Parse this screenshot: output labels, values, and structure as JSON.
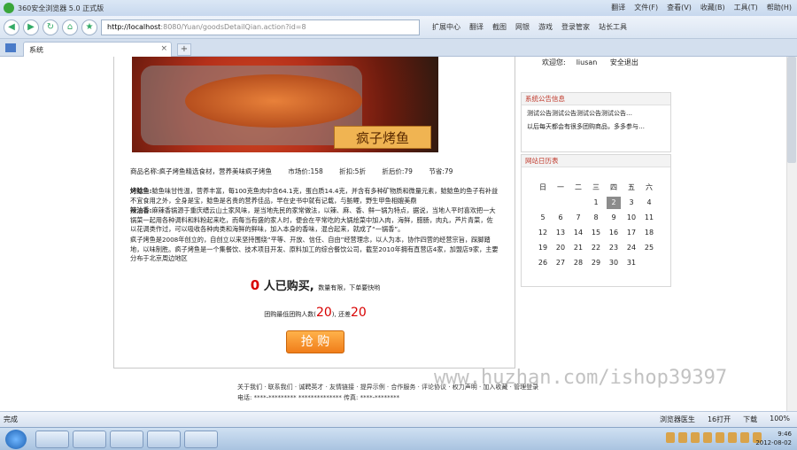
{
  "browser": {
    "title": "360安全浏览器 5.0 正式版",
    "menus": [
      "翻译",
      "文件(F)",
      "查看(V)",
      "收藏(B)",
      "工具(T)",
      "帮助(H)"
    ],
    "address_host": "http://localhost",
    "address_rest": ":8080/Yuan/goodsDetailQian.action?id=8",
    "tools": [
      "扩展中心",
      "翻译",
      "截图",
      "网银",
      "游戏",
      "登录管家",
      "站长工具"
    ],
    "tab_label": "系统",
    "tab_close": "×",
    "new_tab": "+",
    "status_text": "完成",
    "status_items": [
      "浏览器医生",
      "16打开",
      "下载",
      "100%"
    ]
  },
  "user": {
    "greeting": "欢迎您:",
    "name": "liusan",
    "logout": "安全退出"
  },
  "notice": {
    "title": "系统公告信息",
    "items": [
      "测试公告测试公告测试公告测试公告…",
      "以后每天都会有很多团购商品，多多参与…"
    ]
  },
  "calendar": {
    "title": "网站日历表",
    "weekdays": [
      "日",
      "一",
      "二",
      "三",
      "四",
      "五",
      "六"
    ],
    "rows": [
      [
        "",
        "",
        "",
        "1",
        "2",
        "3",
        "4"
      ],
      [
        "5",
        "6",
        "7",
        "8",
        "9",
        "10",
        "11"
      ],
      [
        "12",
        "13",
        "14",
        "15",
        "16",
        "17",
        "18"
      ],
      [
        "19",
        "20",
        "21",
        "22",
        "23",
        "24",
        "25"
      ],
      [
        "26",
        "27",
        "28",
        "29",
        "30",
        "31",
        ""
      ]
    ],
    "today": "2"
  },
  "product": {
    "image_sign": "疯子烤鱼",
    "name_label": "商品名称:疯子烤鱼精选食材，营养美味疯子烤鱼",
    "market_price": "市场价:158",
    "discount": "折扣:5折",
    "discount_price": "折后价:79",
    "saving": "节省:79",
    "desc_head1": "烤鲶鱼:",
    "desc_p1": "鲶鱼味甘性温，营养丰富，每100克鱼肉中含64.1克，蛋白质14.4克，并含有多种矿物质和微量元素，鲶鲶鱼的鱼子有补益不宜食用之外，全身是宝，鲶鱼是名贵的营养佳品，早在史书中就有记载，与鲂鲤，野生甲鱼相媲美鼎",
    "desc_head2": "辣油香:",
    "desc_p2": "麻辣香锅源于重庆缙云山土家风味，是当地先民的家常做法，以辣、麻、香、鲜一锅为特点，据说，当地人平时喜欢把一大锅菜一起用各种调料和料粉起来吃，而每当有盛的家人时，便会在平常吃的大锅烩菜中加入肉，海鲜，腊肠，肉丸，芦片青菜，佐以花调类作过，可以吸收各种肉类和海鲜的鲜味，加入本身的香味，混合起来，就成了“一锅香”。",
    "desc_p3": "疯子烤鱼是2008年创立的，自创立以来坚持围绕“平等、开放、信任、自由”经营理念，以人为本，协作四营的经营宗旨，踩脚踏地，以味制胜。疯子烤鱼是一个集餐饮、技术项目开发、原料加工的综合餐饮公司，截至2010年拥有直营店4家，加盟店9家，主要分布于北京周边地区",
    "bought_num": "0",
    "bought_text": "人已购买,",
    "bought_note": "数量有限，下单要快哟",
    "needed_prefix": "团购最低团购人数(",
    "needed_min": "20",
    "needed_mid": "), 还差",
    "needed_left": "20",
    "buy_button": "抢 购"
  },
  "footer": {
    "links": "关于我们 · 联系我们 · 诚聘英才 · 友情链接 · 提异示例 · 合作服务 · 评论协议 · 权力声明 · 加入收藏 · 管理登录",
    "contact": "电话: ****-********* **************  传真: ****-********"
  },
  "watermark": "www.huzhan.com/ishop39397",
  "taskbar": {
    "time": "9:46",
    "date": "2012-08-02"
  }
}
